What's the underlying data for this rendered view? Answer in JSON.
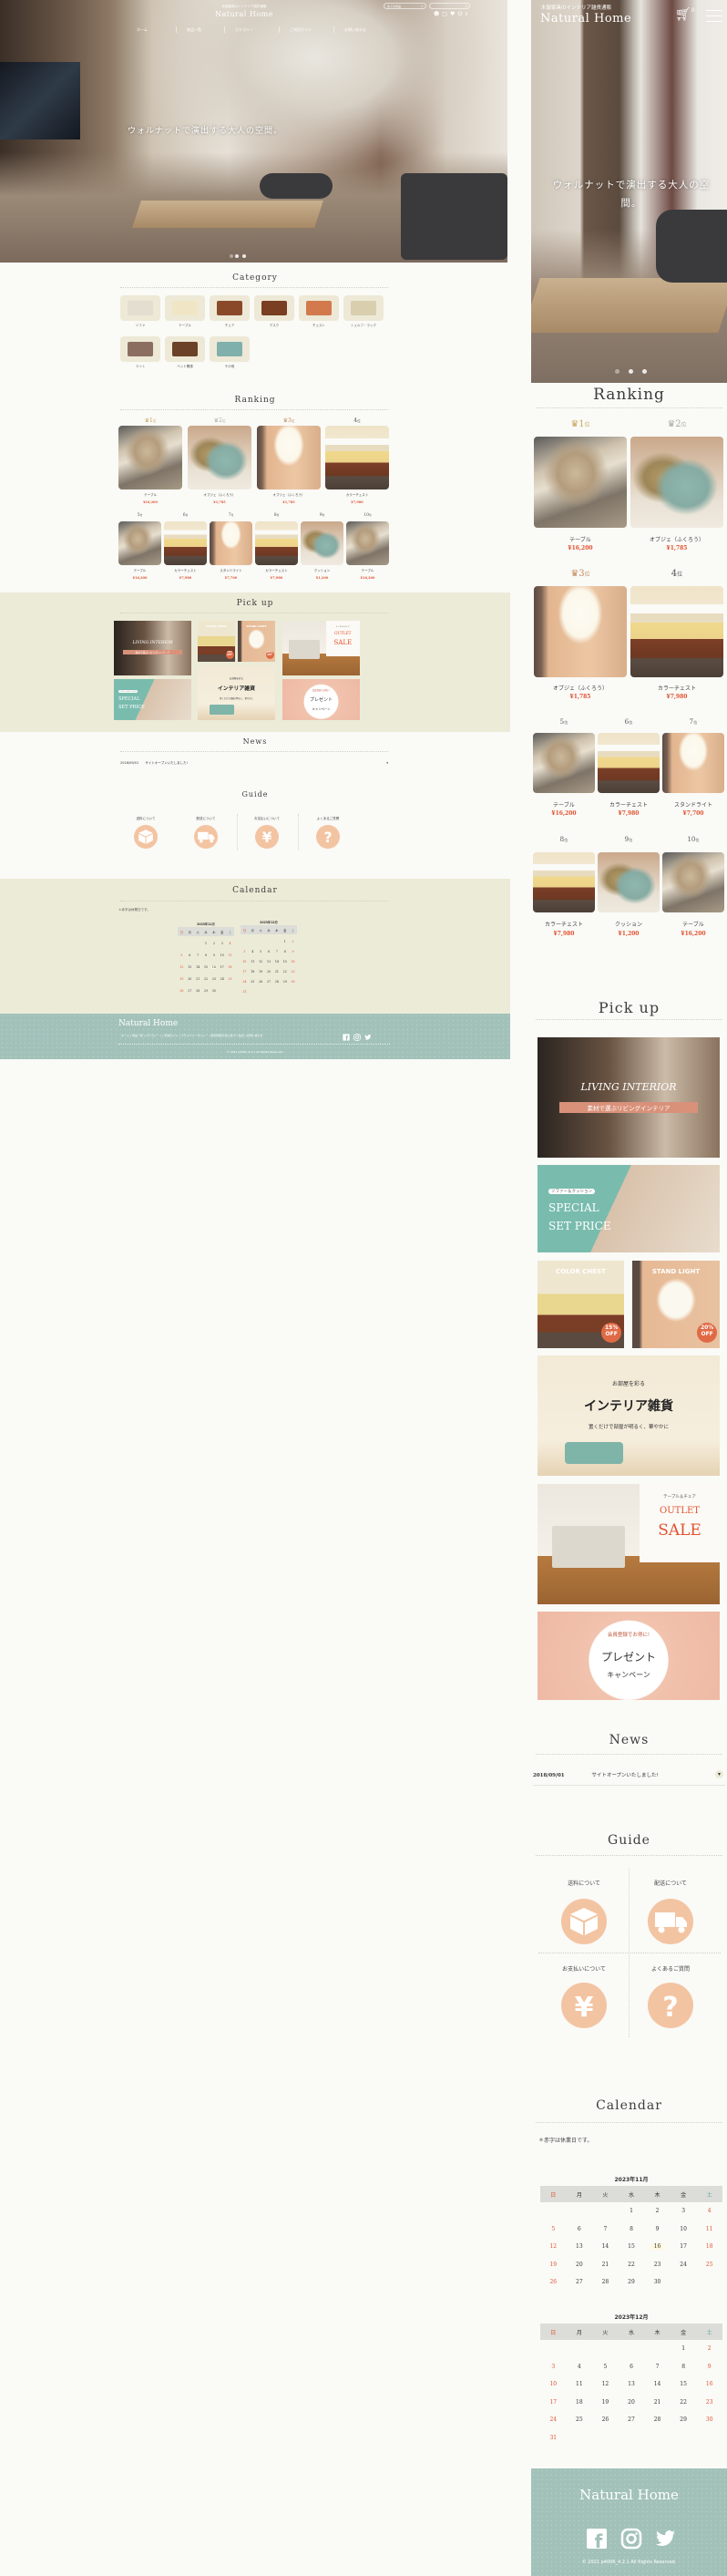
{
  "brand": {
    "logo": "Natural Home",
    "tagline": "木製家具のインテリア雑貨通販",
    "accent": "#e0522f",
    "footer_color": "#a2c2b9",
    "band_color": "#ecebd8",
    "guide_color": "#f3c4a2"
  },
  "header": {
    "nav": [
      "ホーム",
      "商品一覧",
      "カテゴリー",
      "ご利用ガイド",
      "お問い合わせ"
    ],
    "search_select": "全ての商品",
    "search_placeholder": "",
    "icons": [
      "user-icon",
      "lock-icon",
      "heart-icon",
      "cart-icon"
    ],
    "cart_count": "0"
  },
  "hero": {
    "caption": "ウォルナットで演出する大人の空間。",
    "slides": 3,
    "active_slide": 2
  },
  "category": {
    "title": "Category",
    "items": [
      "ソファ",
      "テーブル",
      "チェア",
      "デスク",
      "チェスト",
      "シェルフ・ラック",
      "ライト",
      "ベッド関連",
      "その他"
    ]
  },
  "ranking": {
    "title": "Ranking",
    "suffix": "位",
    "items": [
      {
        "rank": "1",
        "name": "テーブル",
        "price": "¥16,200",
        "img": "table",
        "crown": "#c9a45a"
      },
      {
        "rank": "2",
        "name": "オブジェ（ふくろう）",
        "price": "¥1,785",
        "img": "cushion",
        "crown": "#a9aaa5"
      },
      {
        "rank": "3",
        "name": "オブジェ（ふくろう）",
        "price": "¥1,785",
        "img": "lamp",
        "crown": "#c48a5c"
      },
      {
        "rank": "4",
        "name": "カラーチェスト",
        "price": "¥7,980",
        "img": "chest"
      },
      {
        "rank": "5",
        "name": "テーブル",
        "price": "¥16,200",
        "img": "table"
      },
      {
        "rank": "6",
        "name": "カラーチェスト",
        "price": "¥7,980",
        "img": "chest"
      },
      {
        "rank": "7",
        "name": "スタンドライト",
        "price": "¥7,700",
        "img": "lamp"
      },
      {
        "rank": "8",
        "name": "カラーチェスト",
        "price": "¥7,980",
        "img": "chest"
      },
      {
        "rank": "9",
        "name": "クッション",
        "price": "¥1,200",
        "img": "cushion"
      },
      {
        "rank": "10",
        "name": "テーブル",
        "price": "¥16,200",
        "img": "table"
      }
    ]
  },
  "pickup": {
    "title": "Pick up",
    "banners": {
      "living": {
        "title": "LIVING INTERIOR",
        "sub": "素材で選ぶリビングインテリア"
      },
      "special": {
        "tag": "ソファー＆クッション",
        "title1": "SPECIAL",
        "title2": "SET PRICE"
      },
      "chest": {
        "title": "COLOR CHEST",
        "pct": "15%",
        "off": "OFF"
      },
      "light": {
        "title": "STAND LIGHT",
        "pct": "20%",
        "off": "OFF"
      },
      "zakka": {
        "pre": "お部屋を彩る",
        "title": "インテリア雑貨",
        "sub": "置くだけで部屋が明るく、華やかに"
      },
      "outlet": {
        "pre": "テーブル＆チェア",
        "title1": "OUTLET",
        "title2": "SALE"
      },
      "present": {
        "pre": "会員登録でお得に!",
        "title1": "プレゼント",
        "title2": "キャンペーン"
      }
    }
  },
  "news": {
    "title": "News",
    "items": [
      {
        "date": "2018/09/01",
        "text": "サイトオープンいたしました!"
      }
    ]
  },
  "guide": {
    "title": "Guide",
    "items": [
      {
        "label": "送料について",
        "icon": "box-icon"
      },
      {
        "label": "配送について",
        "icon": "truck-icon"
      },
      {
        "label": "お支払いについて",
        "icon": "yen-icon"
      },
      {
        "label": "よくあるご質問",
        "icon": "question-icon"
      }
    ]
  },
  "calendar": {
    "title": "Calendar",
    "note": "＊赤字は休業日です。",
    "weekdays": [
      "日",
      "月",
      "火",
      "水",
      "木",
      "金",
      "土"
    ],
    "today": 16,
    "months": [
      {
        "label": "2023年11月",
        "weeks": [
          [
            null,
            null,
            null,
            1,
            2,
            3,
            4
          ],
          [
            5,
            6,
            7,
            8,
            9,
            10,
            11
          ],
          [
            12,
            13,
            14,
            15,
            16,
            17,
            18
          ],
          [
            19,
            20,
            21,
            22,
            23,
            24,
            25
          ],
          [
            26,
            27,
            28,
            29,
            30,
            null,
            null
          ]
        ]
      },
      {
        "label": "2023年12月",
        "weeks": [
          [
            null,
            null,
            null,
            null,
            null,
            1,
            2
          ],
          [
            3,
            4,
            5,
            6,
            7,
            8,
            9
          ],
          [
            10,
            11,
            12,
            13,
            14,
            15,
            16
          ],
          [
            17,
            18,
            19,
            20,
            21,
            22,
            23
          ],
          [
            24,
            25,
            26,
            27,
            28,
            29,
            30
          ],
          [
            31,
            null,
            null,
            null,
            null,
            null,
            null
          ]
        ]
      }
    ]
  },
  "footer": {
    "logo": "Natural Home",
    "links": [
      "ホーム",
      "商品一覧",
      "カテゴリー",
      "ご利用ガイド",
      "プライバシーポリシー",
      "特定商取引法に基づく表記",
      "お問い合わせ"
    ],
    "social": [
      "facebook-icon",
      "instagram-icon",
      "twitter-icon"
    ],
    "copyright": "© 2021 p4006_4.2.1 All Rights Reserved."
  }
}
